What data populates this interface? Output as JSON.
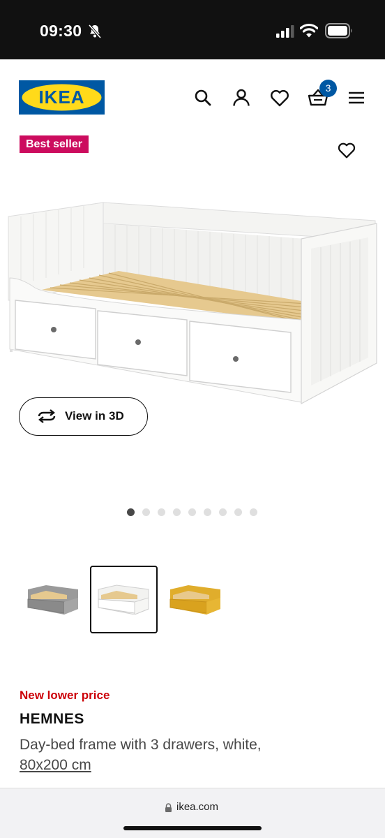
{
  "status_bar": {
    "time": "09:30",
    "icons": [
      "bell-slash-icon",
      "signal-icon",
      "wifi-icon",
      "battery-icon"
    ]
  },
  "header": {
    "logo_text": "IKEA",
    "icons": [
      "search-icon",
      "profile-icon",
      "heart-icon",
      "basket-icon",
      "menu-icon"
    ],
    "cart_count": "3"
  },
  "product_media": {
    "badge": "Best seller",
    "favorite_icon": "heart-icon",
    "view_3d_label": "View in 3D",
    "view_3d_icon": "rotate-arrows-icon",
    "carousel_dots": 9,
    "active_dot": 1,
    "thumbnail_colors": [
      "grey",
      "white",
      "yellow"
    ],
    "selected_thumbnail": 2
  },
  "product_info": {
    "price_label": "New lower price",
    "name": "HEMNES",
    "description": "Day-bed frame with 3 drawers, white,",
    "size": "80x200 cm"
  },
  "browser": {
    "url": "ikea.com",
    "lock_icon": "lock-icon"
  },
  "colors": {
    "ikea_blue": "#0058a3",
    "ikea_yellow": "#ffda1a",
    "best_seller_pink": "#cc0c5e",
    "price_red": "#cc0008"
  }
}
